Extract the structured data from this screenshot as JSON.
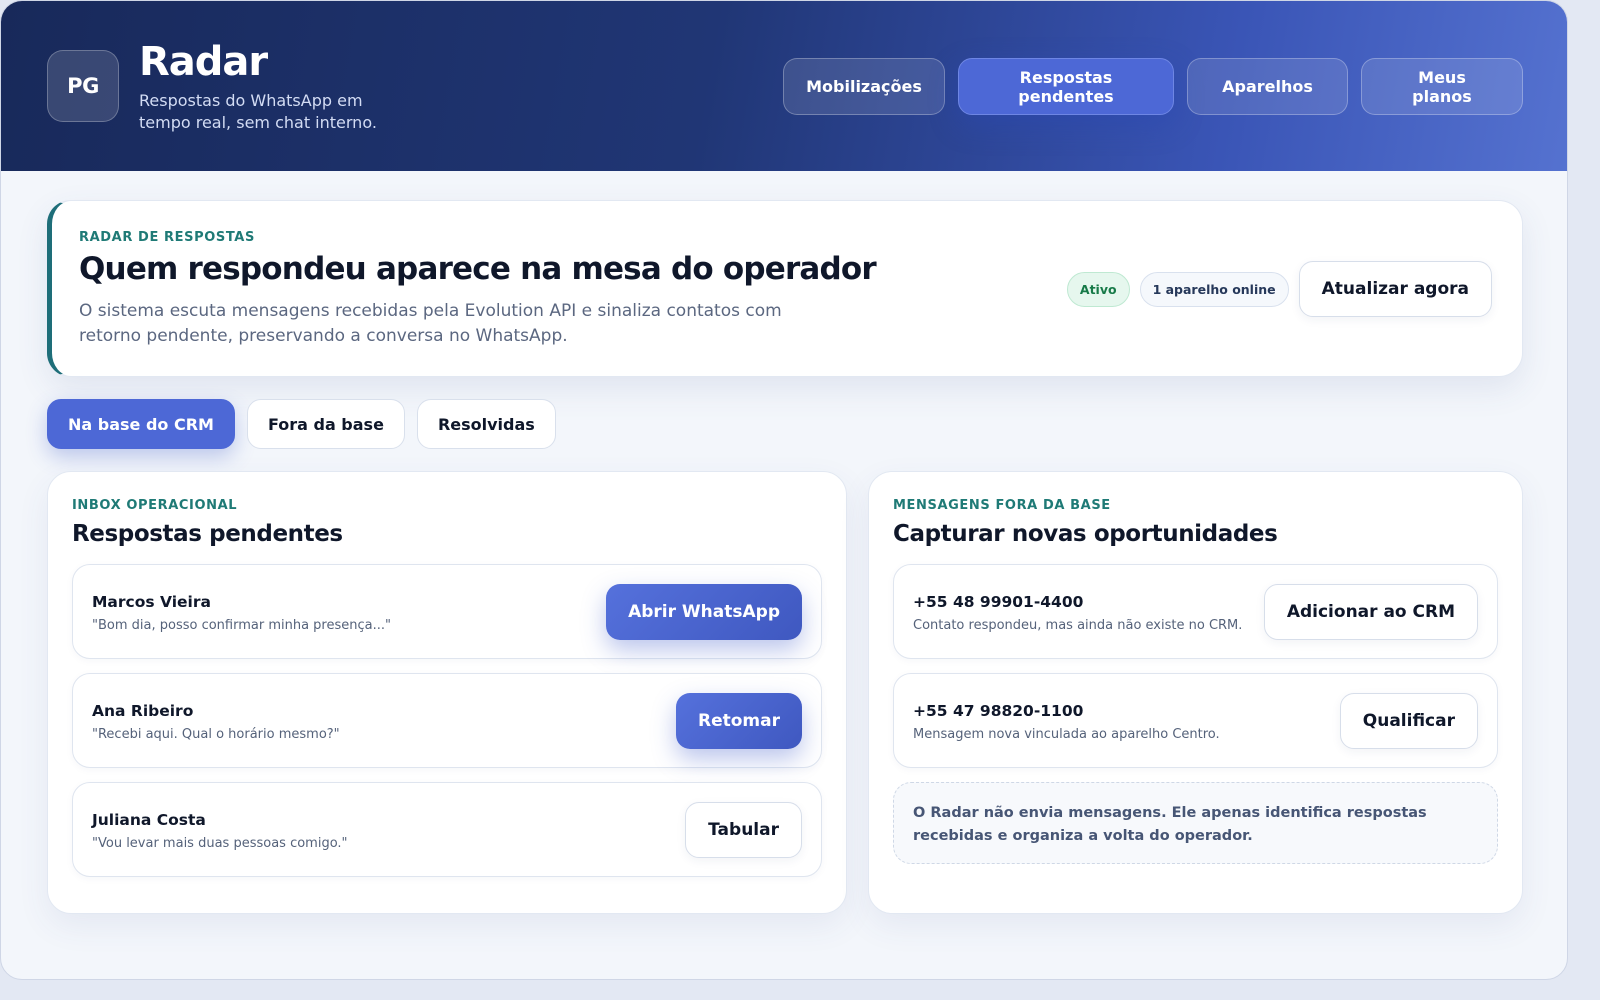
{
  "header": {
    "logo_initials": "PG",
    "title": "Radar",
    "subtitle": "Respostas do WhatsApp em tempo real, sem chat interno.",
    "nav": [
      {
        "label": "Mobilizações",
        "active": false
      },
      {
        "label": "Respostas pendentes",
        "active": true
      },
      {
        "label": "Aparelhos",
        "active": false
      },
      {
        "label": "Meus planos",
        "active": false
      }
    ]
  },
  "hero": {
    "eyebrow": "RADAR DE RESPOSTAS",
    "title": "Quem respondeu aparece na mesa do operador",
    "description": "O sistema escuta mensagens recebidas pela Evolution API e sinaliza contatos com retorno pendente, preservando a conversa no WhatsApp.",
    "status_badge": "Ativo",
    "devices_badge": "1 aparelho online",
    "refresh_label": "Atualizar agora"
  },
  "filters": [
    {
      "label": "Na base do CRM",
      "active": true
    },
    {
      "label": "Fora da base",
      "active": false
    },
    {
      "label": "Resolvidas",
      "active": false
    }
  ],
  "inbox": {
    "eyebrow": "INBOX OPERACIONAL",
    "title": "Respostas pendentes",
    "items": [
      {
        "name": "Marcos Vieira",
        "message": "\"Bom dia, posso confirmar minha presença...\"",
        "action": "Abrir WhatsApp",
        "style": "primary"
      },
      {
        "name": "Ana Ribeiro",
        "message": "\"Recebi aqui. Qual o horário mesmo?\"",
        "action": "Retomar",
        "style": "primary"
      },
      {
        "name": "Juliana Costa",
        "message": "\"Vou levar mais duas pessoas comigo.\"",
        "action": "Tabular",
        "style": "outline"
      }
    ]
  },
  "outside": {
    "eyebrow": "MENSAGENS FORA DA BASE",
    "title": "Capturar novas oportunidades",
    "items": [
      {
        "name": "+55 48 99901-4400",
        "message": "Contato respondeu, mas ainda não existe no CRM.",
        "action": "Adicionar ao CRM",
        "style": "outline"
      },
      {
        "name": "+55 47 98820-1100",
        "message": "Mensagem nova vinculada ao aparelho Centro.",
        "action": "Qualificar",
        "style": "outline"
      }
    ],
    "note": "O Radar não envia mensagens. Ele apenas identifica respostas recebidas e organiza a volta do operador."
  },
  "colors": {
    "accent": "#4d68d6",
    "header_dark": "#18295a",
    "eyebrow": "#1f7a76",
    "success": "#177a48"
  }
}
